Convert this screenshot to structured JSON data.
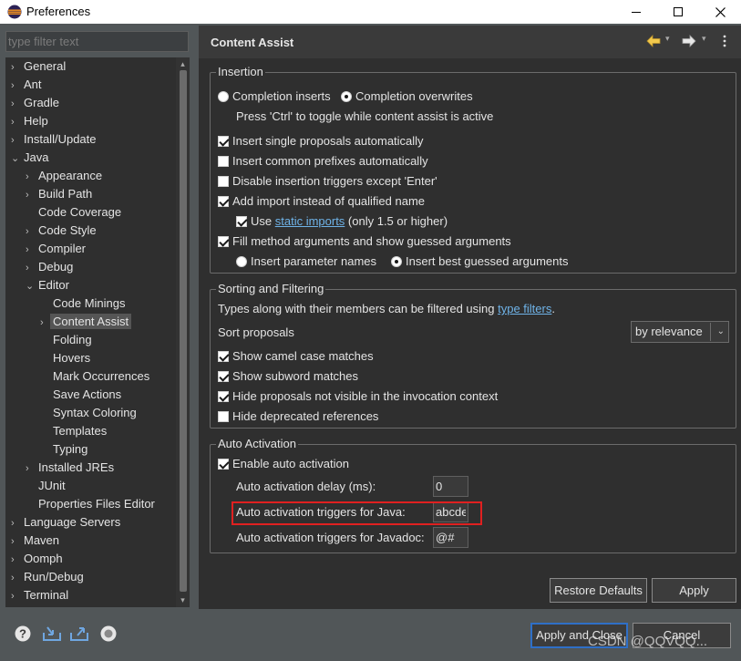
{
  "window": {
    "title": "Preferences",
    "minimize_glyph": "—",
    "maximize_glyph": "☐",
    "close_glyph": "✕"
  },
  "filter": {
    "placeholder": "type filter text"
  },
  "tree": {
    "items": [
      {
        "label": "General",
        "chev": "›"
      },
      {
        "label": "Ant",
        "chev": "›"
      },
      {
        "label": "Gradle",
        "chev": "›"
      },
      {
        "label": "Help",
        "chev": "›"
      },
      {
        "label": "Install/Update",
        "chev": "›"
      },
      {
        "label": "Java",
        "chev": "⌄"
      },
      {
        "label": "Appearance",
        "chev": "›"
      },
      {
        "label": "Build Path",
        "chev": "›"
      },
      {
        "label": "Code Coverage",
        "chev": ""
      },
      {
        "label": "Code Style",
        "chev": "›"
      },
      {
        "label": "Compiler",
        "chev": "›"
      },
      {
        "label": "Debug",
        "chev": "›"
      },
      {
        "label": "Editor",
        "chev": "⌄"
      },
      {
        "label": "Code Minings",
        "chev": ""
      },
      {
        "label": "Content Assist",
        "chev": "›"
      },
      {
        "label": "Folding",
        "chev": ""
      },
      {
        "label": "Hovers",
        "chev": ""
      },
      {
        "label": "Mark Occurrences",
        "chev": ""
      },
      {
        "label": "Save Actions",
        "chev": ""
      },
      {
        "label": "Syntax Coloring",
        "chev": ""
      },
      {
        "label": "Templates",
        "chev": ""
      },
      {
        "label": "Typing",
        "chev": ""
      },
      {
        "label": "Installed JREs",
        "chev": "›"
      },
      {
        "label": "JUnit",
        "chev": ""
      },
      {
        "label": "Properties Files Editor",
        "chev": ""
      },
      {
        "label": "Language Servers",
        "chev": "›"
      },
      {
        "label": "Maven",
        "chev": "›"
      },
      {
        "label": "Oomph",
        "chev": "›"
      },
      {
        "label": "Run/Debug",
        "chev": "›"
      },
      {
        "label": "Terminal",
        "chev": "›"
      }
    ]
  },
  "page": {
    "title": "Content Assist"
  },
  "insertion": {
    "title": "Insertion",
    "completion_inserts": "Completion inserts",
    "completion_overwrites": "Completion overwrites",
    "toggle_hint": "Press 'Ctrl' to toggle while content assist is active",
    "insert_single": "Insert single proposals automatically",
    "insert_common": "Insert common prefixes automatically",
    "disable_triggers": "Disable insertion triggers except 'Enter'",
    "add_import": "Add import instead of qualified name",
    "use_prefix": "Use ",
    "static_imports": "static imports",
    "use_suffix": " (only 1.5 or higher)",
    "fill_args": "Fill method arguments and show guessed arguments",
    "insert_param_names": "Insert parameter names",
    "insert_best_guessed": "Insert best guessed arguments"
  },
  "sorting": {
    "title": "Sorting and Filtering",
    "types_text": "Types along with their members can be filtered using ",
    "type_filters": "type filters",
    "types_end": ".",
    "sort_proposals": "Sort proposals",
    "sort_value": "by relevance",
    "camel_case": "Show camel case matches",
    "subword": "Show subword matches",
    "hide_not_visible": "Hide proposals not visible in the invocation context",
    "hide_deprecated": "Hide deprecated references"
  },
  "auto_activation": {
    "title": "Auto Activation",
    "enable": "Enable auto activation",
    "delay_label": "Auto activation delay (ms):",
    "delay_value": "0",
    "java_label": "Auto activation triggers for Java:",
    "java_value": "abcde",
    "javadoc_label": "Auto activation triggers for Javadoc:",
    "javadoc_value": "@#"
  },
  "buttons": {
    "restore_defaults": "Restore Defaults",
    "apply": "Apply",
    "apply_and_close": "Apply and Close",
    "cancel": "Cancel"
  },
  "watermark": "CSDN @QQVQQ...",
  "colors": {
    "highlight_box": "#e02020",
    "link": "#6fb3e8",
    "default_button_border": "#2f6fc7"
  }
}
